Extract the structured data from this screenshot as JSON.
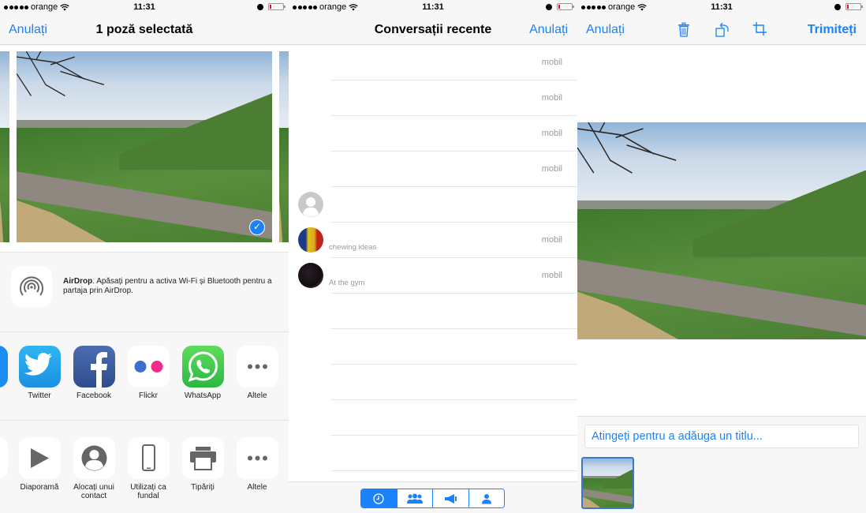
{
  "status_bar": {
    "carrier": "orange",
    "time": "11:31",
    "battery_level_percent": 5
  },
  "share_sheet": {
    "nav": {
      "cancel_label": "Anulați",
      "title": "1 poză selectată"
    },
    "photos": {
      "selected_count": 1,
      "selected_checkmark": "✓"
    },
    "airdrop": {
      "title": "AirDrop",
      "message": ". Apăsați pentru a activa Wi-Fi și Bluetooth pentru a partaja prin AirDrop."
    },
    "share_apps": [
      {
        "label": "Twitter",
        "icon": "twitter-icon"
      },
      {
        "label": "Facebook",
        "icon": "facebook-icon"
      },
      {
        "label": "Flickr",
        "icon": "flickr-icon"
      },
      {
        "label": "WhatsApp",
        "icon": "whatsapp-icon"
      },
      {
        "label": "Altele",
        "icon": "more-icon"
      }
    ],
    "actions": [
      {
        "label": "Diaporamă",
        "icon": "play-icon"
      },
      {
        "label": "Alocați unui contact",
        "icon": "contact-icon"
      },
      {
        "label": "Utilizați ca fundal",
        "icon": "phone-icon"
      },
      {
        "label": "Tipăriți",
        "icon": "printer-icon"
      },
      {
        "label": "Altele",
        "icon": "more-icon"
      }
    ]
  },
  "recent_conversations": {
    "nav": {
      "title": "Conversații recente",
      "cancel_label": "Anulați"
    },
    "rows": [
      {
        "type_label": "mobil",
        "status": "",
        "avatar": "none"
      },
      {
        "type_label": "mobil",
        "status": "",
        "avatar": "none"
      },
      {
        "type_label": "mobil",
        "status": "",
        "avatar": "none"
      },
      {
        "type_label": "mobil",
        "status": "",
        "avatar": "none"
      },
      {
        "type_label": "",
        "status": "",
        "avatar": "placeholder"
      },
      {
        "type_label": "mobil",
        "status": "chewing ideas",
        "avatar": "flag-photo"
      },
      {
        "type_label": "mobil",
        "status": "At the gym",
        "avatar": "dark-photo"
      },
      {
        "type_label": "",
        "status": "",
        "avatar": "none"
      },
      {
        "type_label": "",
        "status": "",
        "avatar": "none"
      },
      {
        "type_label": "",
        "status": "",
        "avatar": "none"
      },
      {
        "type_label": "",
        "status": "",
        "avatar": "none"
      },
      {
        "type_label": "",
        "status": "",
        "avatar": "none"
      }
    ],
    "segments": [
      {
        "icon": "clock-icon",
        "active": true
      },
      {
        "icon": "groups-icon",
        "active": false
      },
      {
        "icon": "megaphone-icon",
        "active": false
      },
      {
        "icon": "person-icon",
        "active": false
      }
    ]
  },
  "compose": {
    "nav": {
      "cancel_label": "Anulați",
      "send_label": "Trimiteți"
    },
    "caption_placeholder": "Atingeți pentru a adăuga un titlu..."
  },
  "colors": {
    "accent": "#1a82fb"
  }
}
